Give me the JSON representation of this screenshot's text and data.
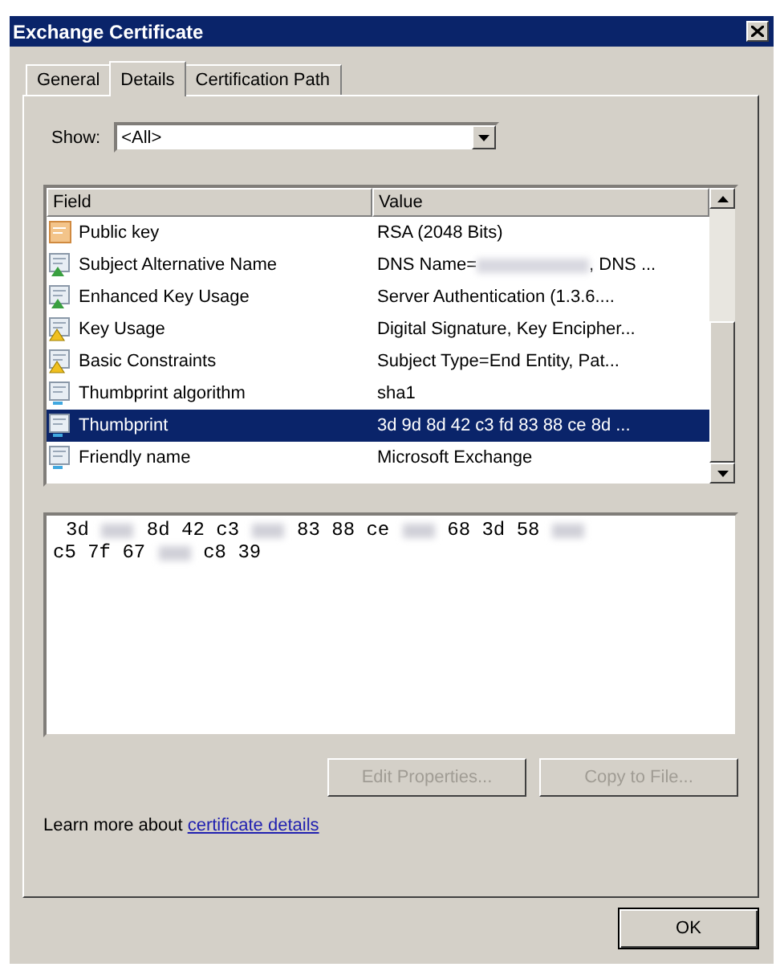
{
  "window": {
    "title": "Exchange Certificate"
  },
  "tabs": [
    {
      "label": "General",
      "selected": false
    },
    {
      "label": "Details",
      "selected": true
    },
    {
      "label": "Certification Path",
      "selected": false
    }
  ],
  "show": {
    "label": "Show:",
    "value": "<All>"
  },
  "table": {
    "columns": [
      "Field",
      "Value"
    ],
    "rows": [
      {
        "kind": "key",
        "field": "Public key",
        "value": [
          {
            "kind": "text",
            "text": "RSA (2048 Bits)"
          }
        ],
        "selected": false
      },
      {
        "kind": "extension",
        "field": "Subject Alternative Name",
        "value": [
          {
            "kind": "text",
            "text": "DNS Name="
          },
          {
            "kind": "redacted"
          },
          {
            "kind": "text",
            "text": ", DNS ..."
          }
        ],
        "selected": false
      },
      {
        "kind": "extension",
        "field": "Enhanced Key Usage",
        "value": [
          {
            "kind": "text",
            "text": "Server Authentication (1.3.6...."
          }
        ],
        "selected": false
      },
      {
        "kind": "critical",
        "field": "Key Usage",
        "value": [
          {
            "kind": "text",
            "text": "Digital Signature, Key Encipher..."
          }
        ],
        "selected": false
      },
      {
        "kind": "critical",
        "field": "Basic Constraints",
        "value": [
          {
            "kind": "text",
            "text": "Subject Type=End Entity, Pat..."
          }
        ],
        "selected": false
      },
      {
        "kind": "property",
        "field": "Thumbprint algorithm",
        "value": [
          {
            "kind": "text",
            "text": "sha1"
          }
        ],
        "selected": false
      },
      {
        "kind": "property",
        "field": "Thumbprint",
        "value": [
          {
            "kind": "text",
            "text": "3d 9d 8d 42 c3 fd 83 88 ce 8d ..."
          }
        ],
        "selected": true
      },
      {
        "kind": "property",
        "field": "Friendly name",
        "value": [
          {
            "kind": "text",
            "text": "Microsoft Exchange"
          }
        ],
        "selected": false
      }
    ]
  },
  "detail_lines": [
    [
      {
        "kind": "text",
        "text": "3d"
      },
      {
        "kind": "redacted"
      },
      {
        "kind": "text",
        "text": "8d 42 c3"
      },
      {
        "kind": "redacted"
      },
      {
        "kind": "text",
        "text": "83 88 ce"
      },
      {
        "kind": "redacted"
      },
      {
        "kind": "text",
        "text": "68 3d 58"
      },
      {
        "kind": "redacted"
      }
    ],
    [
      {
        "kind": "text",
        "text": "c5 7f 67"
      },
      {
        "kind": "redacted"
      },
      {
        "kind": "text",
        "text": "c8 39"
      }
    ]
  ],
  "buttons": [
    {
      "label": "Edit Properties...",
      "disabled": true
    },
    {
      "label": "Copy to File...",
      "disabled": true
    }
  ],
  "learn_more": {
    "text": "Learn more about",
    "link": "certificate details"
  },
  "ok_button": {
    "label": "OK"
  }
}
